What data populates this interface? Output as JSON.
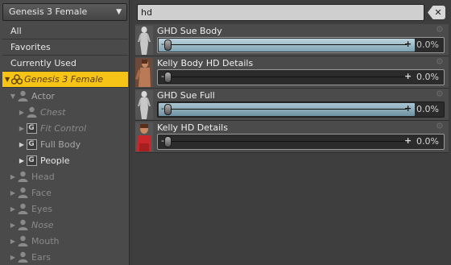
{
  "figure_selector": {
    "label": "Genesis 3 Female",
    "icon": "chevron-down-icon"
  },
  "categories": [
    {
      "label": "All"
    },
    {
      "label": "Favorites"
    },
    {
      "label": "Currently Used"
    },
    {
      "label": "Genesis 3 Female",
      "selected": true
    }
  ],
  "tree": [
    {
      "label": "Actor",
      "icon": "person-icon",
      "expander": "expanded"
    },
    {
      "label": "Chest",
      "icon": "person-icon",
      "expander": "collapsed",
      "italic": true
    },
    {
      "label": "Fit Control",
      "icon": "group-icon",
      "expander": "collapsed",
      "italic": true
    },
    {
      "label": "Full Body",
      "icon": "group-icon",
      "expander": "collapsed"
    },
    {
      "label": "People",
      "icon": "group-icon",
      "expander": "collapsed"
    },
    {
      "label": "Head",
      "icon": "person-icon",
      "expander": "collapsed"
    },
    {
      "label": "Face",
      "icon": "person-icon",
      "expander": "collapsed"
    },
    {
      "label": "Eyes",
      "icon": "person-icon",
      "expander": "collapsed"
    },
    {
      "label": "Nose",
      "icon": "person-icon",
      "expander": "collapsed",
      "italic": true
    },
    {
      "label": "Mouth",
      "icon": "person-icon",
      "expander": "collapsed"
    },
    {
      "label": "Ears",
      "icon": "person-icon",
      "expander": "collapsed"
    }
  ],
  "search": {
    "value": "hd",
    "clear_icon": "clear-icon"
  },
  "properties": [
    {
      "name": "GHD Sue Body",
      "value": "0.0%",
      "thumb": "grey-figure-thumbnail"
    },
    {
      "name": "Kelly Body HD Details",
      "value": "0.0%",
      "thumb": "tan-figure-thumbnail"
    },
    {
      "name": "GHD Sue Full",
      "value": "0.0%",
      "thumb": "grey-figure-thumbnail"
    },
    {
      "name": "Kelly HD Details",
      "value": "0.0%",
      "thumb": "red-figure-thumbnail"
    }
  ],
  "colors": {
    "selection": "#f5c416",
    "slider_fill": "#9dbccb"
  }
}
